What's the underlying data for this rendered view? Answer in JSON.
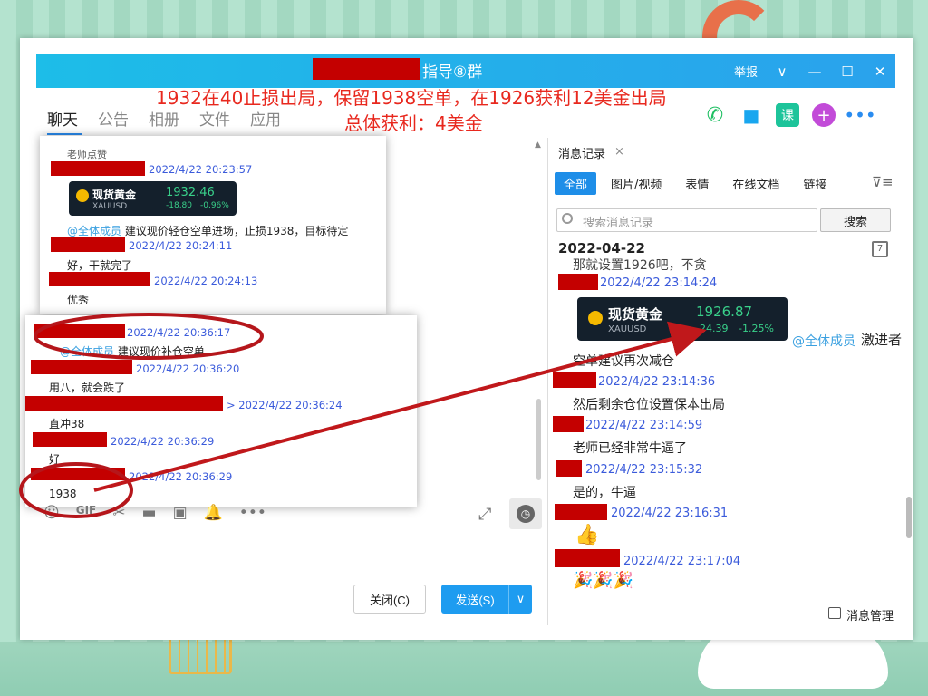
{
  "window": {
    "title": "指导⑧群",
    "report_label": "举报",
    "chevron": "∨",
    "minimize": "—",
    "maximize": "☐",
    "close": "✕"
  },
  "annotation": {
    "line1": "1932在40止损出局，保留1938空单，在1926获利12美金出局",
    "line2": "总体获利：4美金"
  },
  "tabs": [
    {
      "label": "聊天"
    },
    {
      "label": "公告"
    },
    {
      "label": "相册"
    },
    {
      "label": "文件"
    },
    {
      "label": "应用"
    }
  ],
  "top_icons": {
    "phone": "✆",
    "video": "■",
    "course": "课",
    "plus": "+",
    "more": "•••"
  },
  "chat_card1": {
    "top_partial": "老师点赞",
    "ts1": "2022/4/22 20:23:57",
    "ticker": {
      "name": "现货黄金",
      "code": "XAUUSD",
      "price": "1932.46",
      "change": "-18.80",
      "pct": "-0.96%"
    },
    "mention_prefix": "@全体成员",
    "msg1": "建议现价轻仓空单进场，止损1938，目标待定",
    "ts2": "2022/4/22 20:24:11",
    "msg2": "好，干就完了",
    "ts3": "2022/4/22 20:24:13",
    "msg3": "优秀"
  },
  "chat_card2": {
    "ts1": "2022/4/22 20:36:17",
    "mention_prefix": "@全体成员",
    "msg1": "建议现价补仓空单",
    "ts2": "2022/4/22 20:36:20",
    "msg2": "用八，就会跌了",
    "ts3": "> 2022/4/22 20:36:24",
    "msg3": "直冲38",
    "ts4": "2022/4/22 20:36:29",
    "msg4": "好",
    "ts5": "2022/4/22 20:36:29",
    "msg5": "1938"
  },
  "toolbar_icons": [
    "☺",
    "GIF",
    "✂",
    "▬",
    "▣",
    "🔔",
    "•••"
  ],
  "expand_icon": "⤢",
  "buttons": {
    "close": "关闭(C)",
    "send": "发送(S)",
    "send_dropdown": "∨"
  },
  "history": {
    "title": "消息记录",
    "close": "×",
    "tabs": [
      "全部",
      "图片/视频",
      "表情",
      "在线文档",
      "链接"
    ],
    "filter_icon": "⊽≡",
    "search_placeholder": "搜索消息记录",
    "search_button": "搜索",
    "date": "2022-04-22",
    "calendar": "7",
    "top_partial": "那就设置1926吧，不贪",
    "items": [
      {
        "ts": "2022/4/22 23:14:24"
      },
      {
        "ts": "2022/4/22 23:14:36",
        "msg": "空单建议再次减仓"
      },
      {
        "ts": "2022/4/22 23:14:59",
        "msg": "然后剩余仓位设置保本出局"
      },
      {
        "ts": "2022/4/22 23:15:32",
        "msg": "老师已经非常牛逼了"
      },
      {
        "ts": "2022/4/22 23:16:31",
        "msg": "是的，牛逼"
      },
      {
        "ts": "2022/4/22 23:17:04",
        "msg": "👍"
      }
    ],
    "ticker": {
      "name": "现货黄金",
      "code": "XAUUSD",
      "price": "1926.87",
      "change": "-24.39",
      "pct": "-1.25%"
    },
    "mention": "@全体成员",
    "mention_tail": "激进者",
    "party": "🎉🎉🎉",
    "management": "消息管理"
  },
  "colors": {
    "accent": "#1e9cf0",
    "redaction": "#c40000",
    "annotation": "#e8281e",
    "timestamp": "#3b5bdb"
  }
}
